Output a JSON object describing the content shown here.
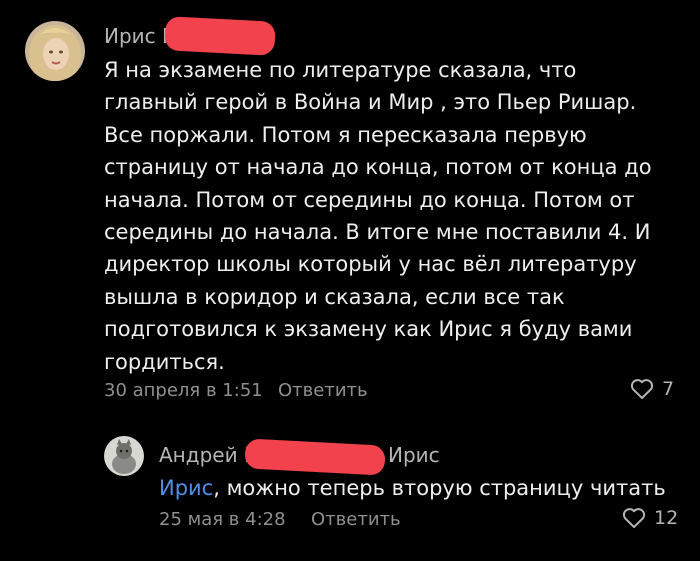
{
  "comments": [
    {
      "author": "Ирис Г",
      "text": "Я на экзамене по литературе сказала, что\nглавный герой в Война и Мир , это Пьер Ришар.\nВсе поржали. Потом я пересказала первую\nстраницу от начала до конца, потом от конца до\nначала. Потом от середины до конца. Потом от\nсередины до начала. В итоге мне поставили 4. И\nдиректор школы который у нас вёл литературу\nвышла в коридор и сказала, если все так\nподготовился к экзамену как Ирис я буду вами\nгордиться.",
      "date": "30 апреля в 1:51",
      "reply_label": "Ответить",
      "likes": "7"
    },
    {
      "author": "Андрей Б",
      "reply_to": "Ирис",
      "mention": "Ирис",
      "text": ", можно теперь вторую страницу читать",
      "date": "25 мая в 4:28",
      "reply_label": "Ответить",
      "likes": "12"
    }
  ],
  "colors": {
    "background": "#000000",
    "mention": "#4f8fe8",
    "redaction": "#f2424e"
  },
  "icons": {
    "like": "heart-icon"
  }
}
